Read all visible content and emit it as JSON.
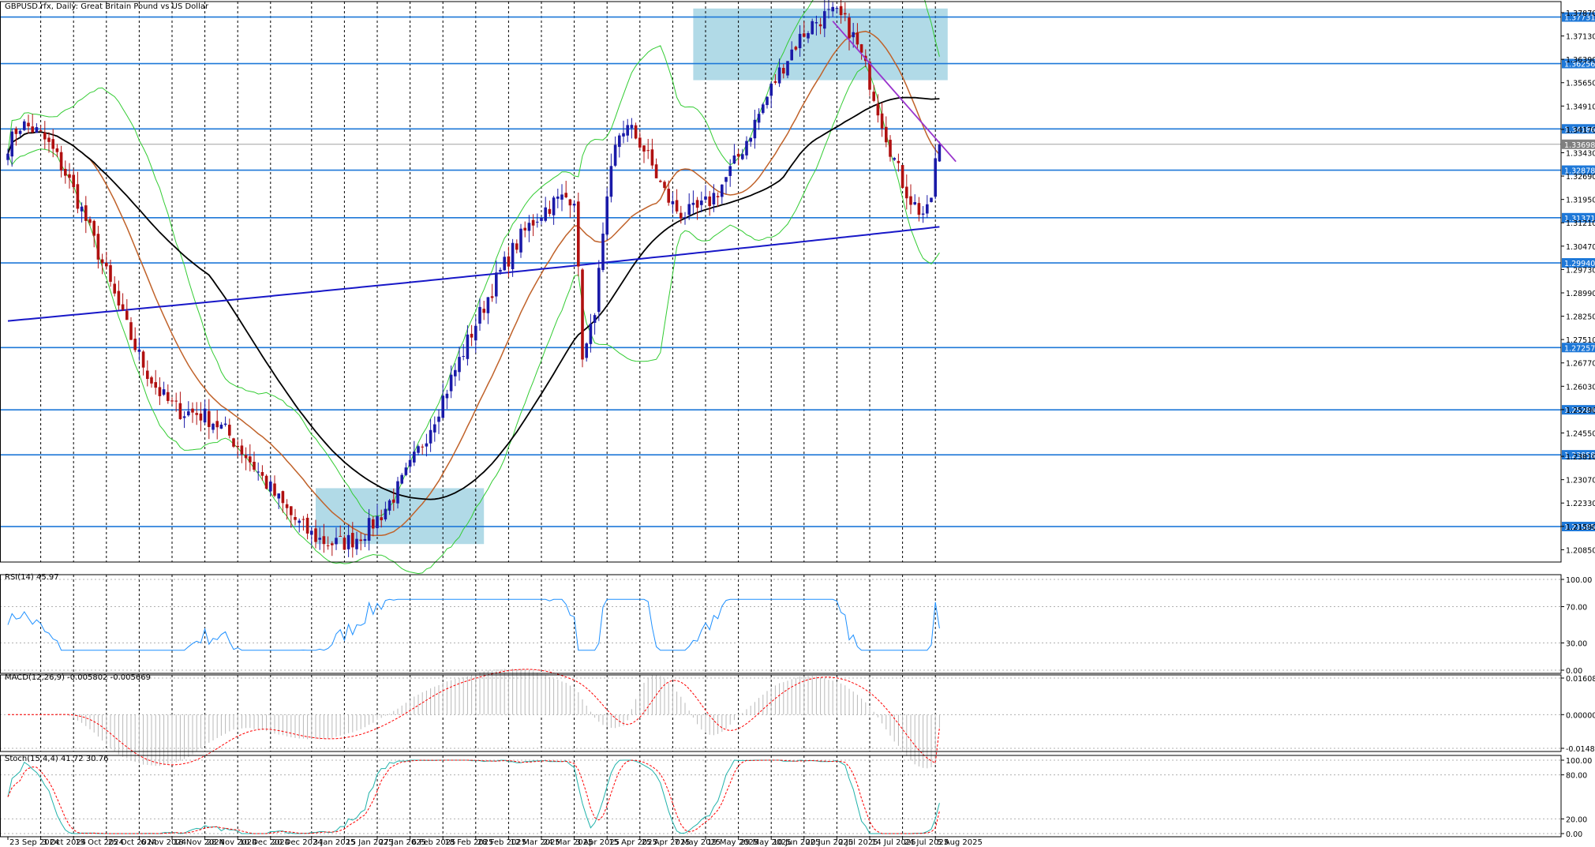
{
  "chart_data": {
    "type": "candlestick",
    "title": "GBPUSD.rfx, Daily:  Great Britain Pound vs US Dollar",
    "symbol": "GBPUSD.rfx",
    "timeframe": "Daily",
    "description": "Great Britain Pound vs US Dollar",
    "ylim": [
      1.2046,
      1.3822
    ],
    "price_ticks": [
      "1.37870",
      "1.37130",
      "1.36390",
      "1.35650",
      "1.34910",
      "1.34170",
      "1.33430",
      "1.32690",
      "1.31950",
      "1.31210",
      "1.30470",
      "1.29730",
      "1.28990",
      "1.28250",
      "1.27510",
      "1.26770",
      "1.26030",
      "1.25290",
      "1.24550",
      "1.23810",
      "1.23070",
      "1.22330",
      "1.21590",
      "1.20850"
    ],
    "date_labels": [
      "23 Sep 2024",
      "3 Oct 2024",
      "15 Oct 2024",
      "25 Oct 2024",
      "6 Nov 2024",
      "18 Nov 2024",
      "28 Nov 2024",
      "10 Dec 2024",
      "20 Dec 2024",
      "3 Jan 2025",
      "15 Jan 2025",
      "27 Jan 2025",
      "6 Feb 2025",
      "18 Feb 2025",
      "28 Feb 2025",
      "12 Mar 2025",
      "24 Mar 2025",
      "3 Apr 2025",
      "15 Apr 2025",
      "25 Apr 2025",
      "7 May 2025",
      "19 May 2025",
      "29 May 2025",
      "10 Jun 2025",
      "20 Jun 2025",
      "2 Jul 2025",
      "14 Jul 2025",
      "24 Jul 2025",
      "5 Aug 2025"
    ],
    "horizontal_levels": [
      {
        "label": "1.37731",
        "value": 1.37731
      },
      {
        "label": "1.36256",
        "value": 1.36256
      },
      {
        "label": "1.34186",
        "value": 1.34186
      },
      {
        "label": "1.32878",
        "value": 1.32878
      },
      {
        "label": "1.31371",
        "value": 1.31371
      },
      {
        "label": "1.29940",
        "value": 1.2994
      },
      {
        "label": "1.27257",
        "value": 1.27257
      },
      {
        "label": "1.25284",
        "value": 1.25284
      },
      {
        "label": "1.23858",
        "value": 1.23858
      },
      {
        "label": "1.21585",
        "value": 1.21585
      }
    ],
    "current_price": {
      "label": "1.33698",
      "value": 1.33698
    },
    "zones": [
      {
        "from_date": "6 Jan 2025",
        "to_date": "4 Mar 2025",
        "low": 1.2103,
        "high": 1.228
      },
      {
        "from_date": "14 May 2025",
        "to_date": "8 Aug 2025",
        "low": 1.3573,
        "high": 1.38
      }
    ],
    "trendline": {
      "from_date": "1 Jul 2025",
      "from": 1.376,
      "to_date": "12 Aug 2025",
      "to": 1.3315
    },
    "key_swings": [
      {
        "date": "26 Sep 2024",
        "price": 1.343
      },
      {
        "date": "22 Nov 2024",
        "price": 1.252
      },
      {
        "date": "13 Jan 2025",
        "price": 1.2105
      },
      {
        "date": "3 Apr 2025",
        "price": 1.3205
      },
      {
        "date": "7 Apr 2025",
        "price": 1.271
      },
      {
        "date": "21 Apr 2025",
        "price": 1.342
      },
      {
        "date": "12 May 2025",
        "price": 1.315
      },
      {
        "date": "1 Jul 2025",
        "price": 1.378
      },
      {
        "date": "1 Aug 2025",
        "price": 1.315
      },
      {
        "date": "6 Aug 2025",
        "price": 1.337
      }
    ],
    "indicators": {
      "rsi": {
        "label": "RSI(14) 45.97",
        "value": 45.97,
        "levels": [
          "100.00",
          "70.00",
          "30.00",
          "0.00"
        ]
      },
      "macd": {
        "label": "MACD(12,26,9) -0.005802 -0.005669",
        "main": -0.005802,
        "signal": -0.005669,
        "levels": [
          "0.016085",
          "0.000000",
          "-0.014818"
        ]
      },
      "stoch": {
        "label": "Stoch(15,4,4) 41.72 30.76",
        "k": 41.72,
        "d": 30.76,
        "levels": [
          "100.00",
          "80.00",
          "20.00",
          "0.00"
        ]
      }
    },
    "colors": {
      "bull": "#1a1aa8",
      "bear": "#b01010",
      "level": "#1e78d8",
      "zone": "#add8e6",
      "trend": "#9933cc",
      "ma_fast": "#c0622a",
      "ma_mid": "#000000",
      "ma_slow": "#1818c8",
      "bands": "#33cc33",
      "rsi": "#1e90ff",
      "macd_signal": "#ff0000",
      "stoch_k": "#20b2aa",
      "stoch_d": "#ff0000"
    }
  }
}
